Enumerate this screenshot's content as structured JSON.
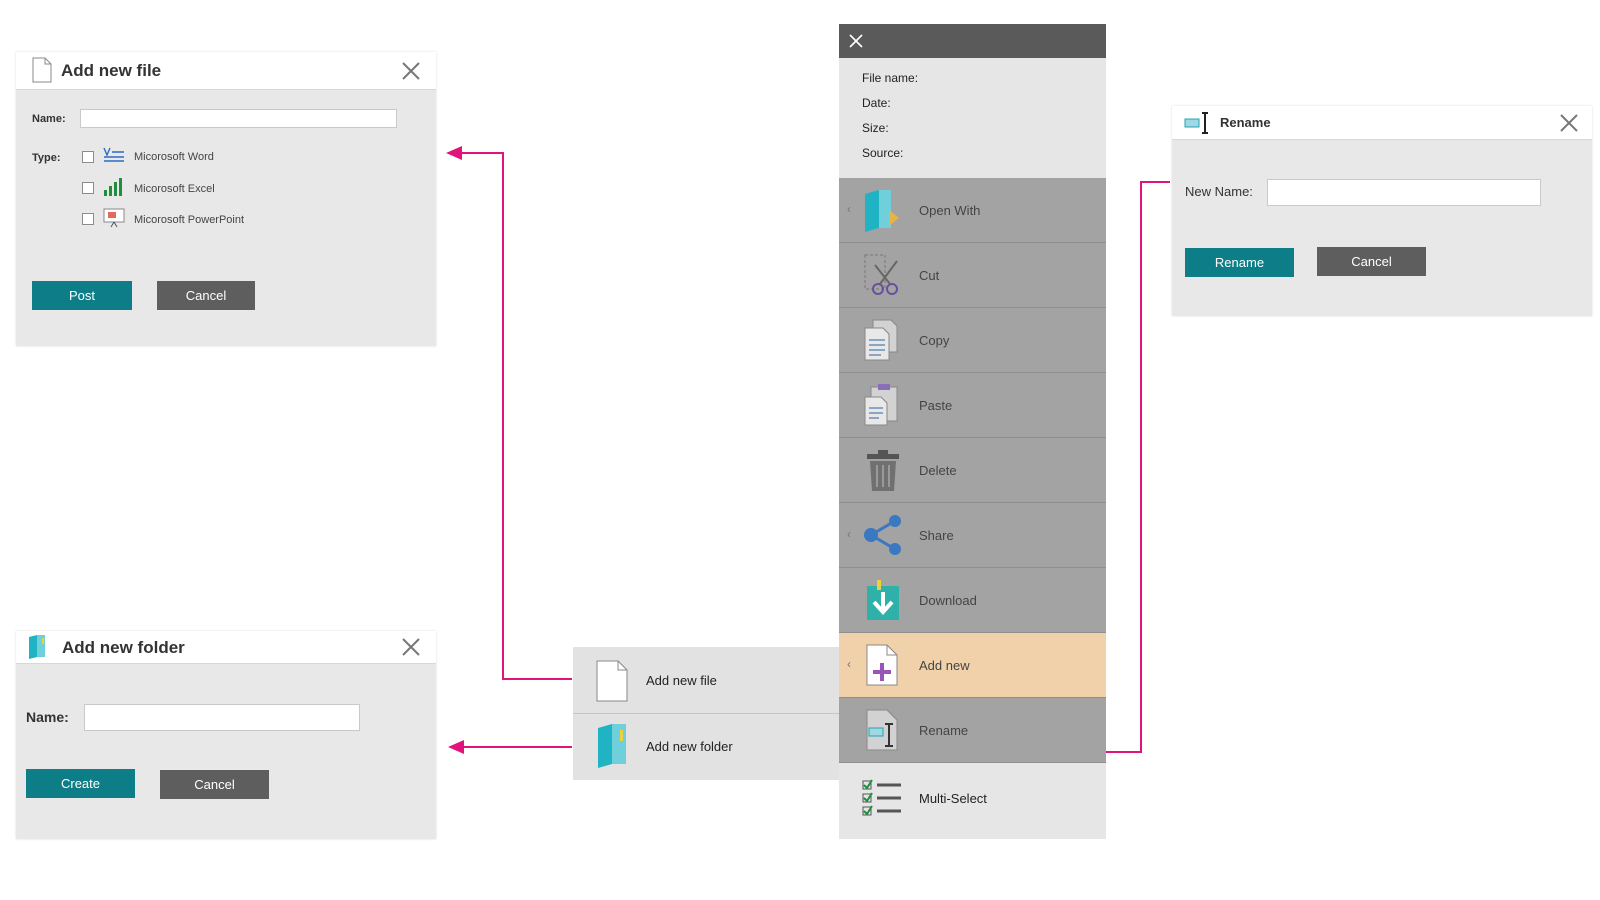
{
  "add_file_dialog": {
    "title": "Add new file",
    "name_label": "Name:",
    "name_value": "",
    "type_label": "Type:",
    "types": [
      {
        "label": "Micorosoft Word",
        "icon": "word-doc-icon",
        "checked": false
      },
      {
        "label": "Micorosoft Excel",
        "icon": "excel-chart-icon",
        "checked": false
      },
      {
        "label": "Micorosoft PowerPoint",
        "icon": "powerpoint-slide-icon",
        "checked": false
      }
    ],
    "post_label": "Post",
    "cancel_label": "Cancel"
  },
  "add_folder_dialog": {
    "title": "Add new folder",
    "name_label": "Name:",
    "name_value": "",
    "create_label": "Create",
    "cancel_label": "Cancel"
  },
  "rename_dialog": {
    "title": "Rename",
    "new_name_label": "New Name:",
    "new_name_value": "",
    "rename_label": "Rename",
    "cancel_label": "Cancel"
  },
  "panel": {
    "info": {
      "file_name": "File name:",
      "date": "Date:",
      "size": "Size:",
      "source": "Source:"
    },
    "items": [
      {
        "label": "Open With",
        "icon": "open-with-icon",
        "submenu": true
      },
      {
        "label": "Cut",
        "icon": "scissors-icon",
        "submenu": false
      },
      {
        "label": "Copy",
        "icon": "copy-icon",
        "submenu": false
      },
      {
        "label": "Paste",
        "icon": "paste-icon",
        "submenu": false
      },
      {
        "label": "Delete",
        "icon": "trash-icon",
        "submenu": false
      },
      {
        "label": "Share",
        "icon": "share-icon",
        "submenu": true
      },
      {
        "label": "Download",
        "icon": "download-icon",
        "submenu": false
      },
      {
        "label": "Add new",
        "icon": "add-new-icon",
        "submenu": true,
        "active": true
      },
      {
        "label": "Rename",
        "icon": "rename-icon",
        "submenu": false
      },
      {
        "label": "Multi-Select",
        "icon": "multi-select-icon",
        "submenu": false
      }
    ]
  },
  "submenu": {
    "items": [
      {
        "label": "Add new file",
        "icon": "file-icon"
      },
      {
        "label": "Add new folder",
        "icon": "folder-icon"
      }
    ]
  },
  "colors": {
    "accent": "#0d7e87",
    "connector": "#e0147a",
    "active_item": "#f1d1a9",
    "dark_button": "#5e5e5e"
  }
}
